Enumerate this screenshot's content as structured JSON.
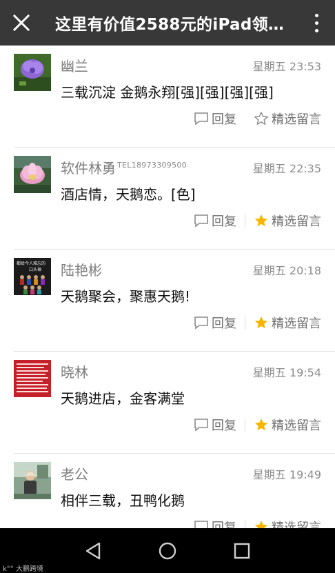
{
  "header": {
    "title": "这里有价值2588元的iPad领…",
    "close_icon": "close-icon",
    "menu_icon": "more-vertical-icon"
  },
  "comments": [
    {
      "name": "幽兰",
      "tel": "",
      "time": "星期五 23:53",
      "text": "三载沉淀 金鹅永翔[强][强][强][强]",
      "reply_label": "回复",
      "featured_label": "精选留言",
      "featured": false
    },
    {
      "name": "软件林勇",
      "tel": "TEL18973309500",
      "time": "星期五 22:35",
      "text": "酒店情，天鹅恋。[色]",
      "reply_label": "回复",
      "featured_label": "精选留言",
      "featured": true
    },
    {
      "name": "陆艳彬",
      "tel": "",
      "time": "星期五 20:18",
      "text": "天鹅聚会，聚惠天鹅!",
      "reply_label": "回复",
      "featured_label": "精选留言",
      "featured": true
    },
    {
      "name": "晓林",
      "tel": "",
      "time": "星期五 19:54",
      "text": "天鹅进店，金客满堂",
      "reply_label": "回复",
      "featured_label": "精选留言",
      "featured": true
    },
    {
      "name": "老公",
      "tel": "",
      "time": "星期五 19:49",
      "text": "相伴三载，丑鸭化鹅",
      "reply_label": "回复",
      "featured_label": "精选留言",
      "featured": true
    }
  ],
  "avatar_texts": {
    "avatar3_line1": "都给今人难忘的",
    "avatar3_line2": "口头禅"
  },
  "navbar": {
    "back_icon": "back-triangle-icon",
    "home_icon": "home-circle-icon",
    "recents_icon": "recents-square-icon"
  },
  "watermark": "大鹏跨境",
  "colors": {
    "topbar": "#383838",
    "star_active": "#f7b500",
    "text_muted": "#7d7d7d",
    "navbar": "#000000"
  }
}
